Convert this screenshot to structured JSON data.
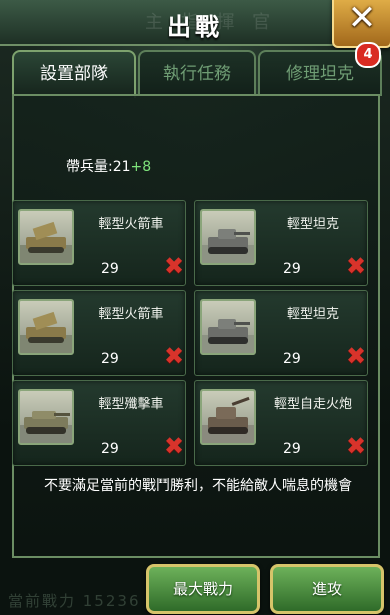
{
  "header": {
    "title": "出戰",
    "ghost_text": "主 指 揮 官"
  },
  "notification_count": "4",
  "tabs": [
    {
      "label": "設置部隊",
      "active": true
    },
    {
      "label": "執行任務",
      "active": false
    },
    {
      "label": "修理坦克",
      "active": false
    }
  ],
  "troops": {
    "label": "帶兵量:",
    "value": "21",
    "bonus": "+8"
  },
  "units": [
    {
      "name": "輕型火箭車",
      "count": "29",
      "icon": "rocket-truck-icon"
    },
    {
      "name": "輕型坦克",
      "count": "29",
      "icon": "light-tank-icon"
    },
    {
      "name": "輕型火箭車",
      "count": "29",
      "icon": "rocket-truck-icon"
    },
    {
      "name": "輕型坦克",
      "count": "29",
      "icon": "light-tank-icon"
    },
    {
      "name": "輕型殲擊車",
      "count": "29",
      "icon": "tank-destroyer-icon"
    },
    {
      "name": "輕型自走火炮",
      "count": "29",
      "icon": "self-propelled-gun-icon"
    }
  ],
  "message": "不要滿足當前的戰鬥勝利，不能給敵人喘息的機會",
  "buttons": {
    "max_power": "最大戰力",
    "attack": "進攻"
  },
  "bottom_ghost": "當前戰力 15236",
  "colors": {
    "accent_green": "#7ee37b",
    "remove_red": "#d8332b",
    "frame_green": "#6b8d63",
    "button_gold": "#d6c46a"
  }
}
